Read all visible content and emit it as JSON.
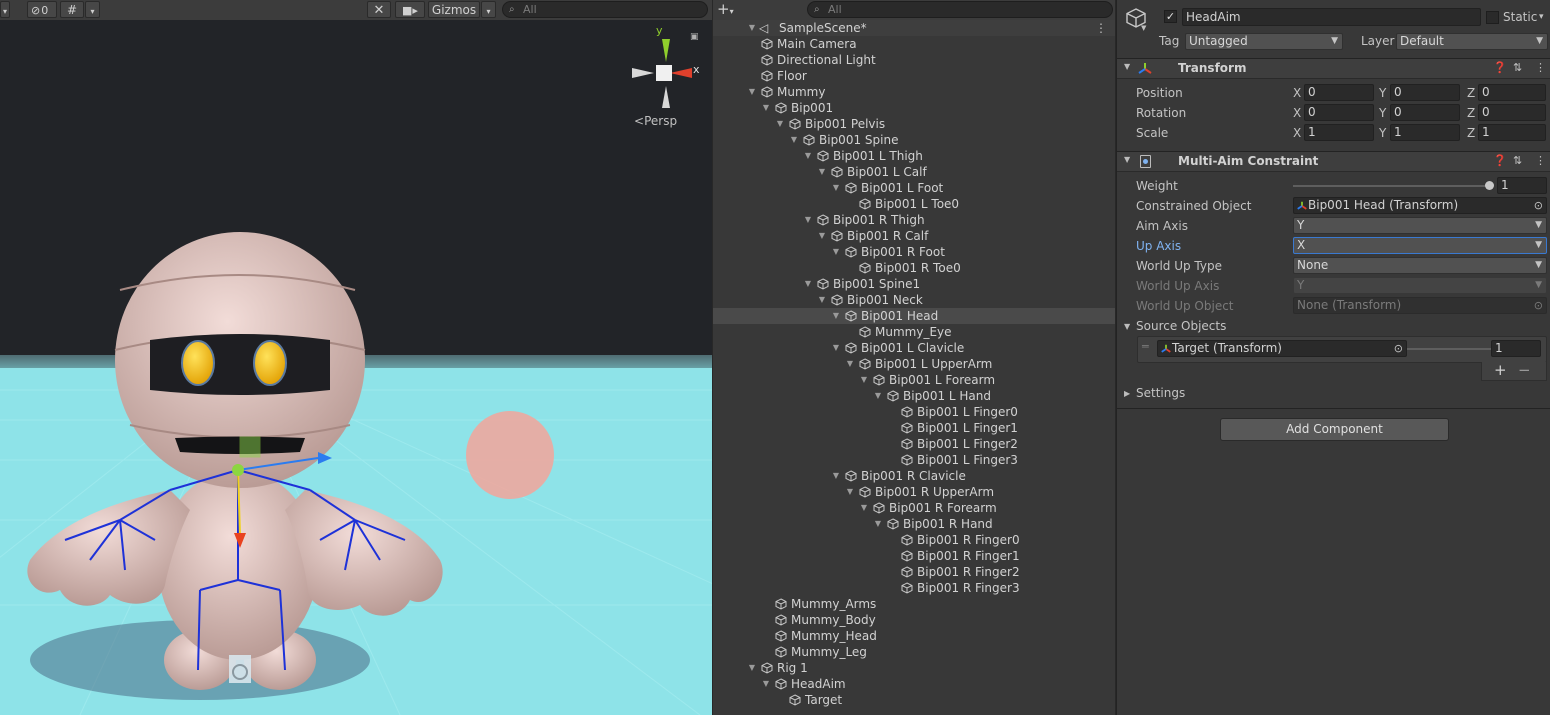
{
  "scene": {
    "toolbar": {
      "hidden_count": "0",
      "gizmos_label": "Gizmos",
      "search_placeholder": "All"
    },
    "gizmo": {
      "y_label": "y",
      "x_label": "x",
      "projection_label": "Persp"
    }
  },
  "hierarchy": {
    "toolbar": {
      "add_label": "+",
      "search_placeholder": "All"
    },
    "scene_name": "SampleScene*",
    "items": [
      {
        "label": "Main Camera",
        "depth": 1,
        "arrow": ""
      },
      {
        "label": "Directional Light",
        "depth": 1,
        "arrow": ""
      },
      {
        "label": "Floor",
        "depth": 1,
        "arrow": ""
      },
      {
        "label": "Mummy",
        "depth": 1,
        "arrow": "down"
      },
      {
        "label": "Bip001",
        "depth": 2,
        "arrow": "down"
      },
      {
        "label": "Bip001 Pelvis",
        "depth": 3,
        "arrow": "down"
      },
      {
        "label": "Bip001 Spine",
        "depth": 4,
        "arrow": "down"
      },
      {
        "label": "Bip001 L Thigh",
        "depth": 5,
        "arrow": "down"
      },
      {
        "label": "Bip001 L Calf",
        "depth": 6,
        "arrow": "down"
      },
      {
        "label": "Bip001 L Foot",
        "depth": 7,
        "arrow": "down"
      },
      {
        "label": "Bip001 L Toe0",
        "depth": 8,
        "arrow": ""
      },
      {
        "label": "Bip001 R Thigh",
        "depth": 5,
        "arrow": "down"
      },
      {
        "label": "Bip001 R Calf",
        "depth": 6,
        "arrow": "down"
      },
      {
        "label": "Bip001 R Foot",
        "depth": 7,
        "arrow": "down"
      },
      {
        "label": "Bip001 R Toe0",
        "depth": 8,
        "arrow": ""
      },
      {
        "label": "Bip001 Spine1",
        "depth": 5,
        "arrow": "down"
      },
      {
        "label": "Bip001 Neck",
        "depth": 6,
        "arrow": "down"
      },
      {
        "label": "Bip001 Head",
        "depth": 7,
        "arrow": "down",
        "selected": true
      },
      {
        "label": "Mummy_Eye",
        "depth": 8,
        "arrow": ""
      },
      {
        "label": "Bip001 L Clavicle",
        "depth": 7,
        "arrow": "down"
      },
      {
        "label": "Bip001 L UpperArm",
        "depth": 8,
        "arrow": "down"
      },
      {
        "label": "Bip001 L Forearm",
        "depth": 9,
        "arrow": "down"
      },
      {
        "label": "Bip001 L Hand",
        "depth": 10,
        "arrow": "down"
      },
      {
        "label": "Bip001 L Finger0",
        "depth": 11,
        "arrow": ""
      },
      {
        "label": "Bip001 L Finger1",
        "depth": 11,
        "arrow": ""
      },
      {
        "label": "Bip001 L Finger2",
        "depth": 11,
        "arrow": ""
      },
      {
        "label": "Bip001 L Finger3",
        "depth": 11,
        "arrow": ""
      },
      {
        "label": "Bip001 R Clavicle",
        "depth": 7,
        "arrow": "down"
      },
      {
        "label": "Bip001 R UpperArm",
        "depth": 8,
        "arrow": "down"
      },
      {
        "label": "Bip001 R Forearm",
        "depth": 9,
        "arrow": "down"
      },
      {
        "label": "Bip001 R Hand",
        "depth": 10,
        "arrow": "down"
      },
      {
        "label": "Bip001 R Finger0",
        "depth": 11,
        "arrow": ""
      },
      {
        "label": "Bip001 R Finger1",
        "depth": 11,
        "arrow": ""
      },
      {
        "label": "Bip001 R Finger2",
        "depth": 11,
        "arrow": ""
      },
      {
        "label": "Bip001 R Finger3",
        "depth": 11,
        "arrow": ""
      },
      {
        "label": "Mummy_Arms",
        "depth": 2,
        "arrow": ""
      },
      {
        "label": "Mummy_Body",
        "depth": 2,
        "arrow": ""
      },
      {
        "label": "Mummy_Head",
        "depth": 2,
        "arrow": ""
      },
      {
        "label": "Mummy_Leg",
        "depth": 2,
        "arrow": ""
      },
      {
        "label": "Rig 1",
        "depth": 1,
        "arrow": "down"
      },
      {
        "label": "HeadAim",
        "depth": 2,
        "arrow": "down"
      },
      {
        "label": "Target",
        "depth": 3,
        "arrow": ""
      }
    ]
  },
  "inspector": {
    "object_name": "HeadAim",
    "active_checked": true,
    "static_label": "Static",
    "tag_label": "Tag",
    "tag_value": "Untagged",
    "layer_label": "Layer",
    "layer_value": "Default",
    "transform": {
      "title": "Transform",
      "position_label": "Position",
      "rotation_label": "Rotation",
      "scale_label": "Scale",
      "x": "X",
      "y": "Y",
      "z": "Z",
      "position": [
        "0",
        "0",
        "0"
      ],
      "rotation": [
        "0",
        "0",
        "0"
      ],
      "scale": [
        "1",
        "1",
        "1"
      ]
    },
    "constraint": {
      "title": "Multi-Aim Constraint",
      "weight_label": "Weight",
      "weight_value": "1",
      "weight_fraction": 1.0,
      "constrained_label": "Constrained Object",
      "constrained_value": "Bip001 Head (Transform)",
      "aim_axis_label": "Aim Axis",
      "aim_axis_value": "Y",
      "up_axis_label": "Up Axis",
      "up_axis_value": "X",
      "world_up_type_label": "World Up Type",
      "world_up_type_value": "None",
      "world_up_axis_label": "World Up Axis",
      "world_up_axis_value": "Y",
      "world_up_object_label": "World Up Object",
      "world_up_object_value": "None (Transform)",
      "source_objects_label": "Source Objects",
      "source_name": "Target (Transform)",
      "source_weight": "1",
      "source_weight_fraction": 1.0,
      "add_symbol": "+",
      "remove_symbol": "−",
      "settings_label": "Settings"
    },
    "add_component_label": "Add Component"
  },
  "colors": {
    "panel_bg": "#383838",
    "toolbar_bg": "#3c3c3c",
    "selection": "#4a4a4a",
    "sky": "#8fe6ea",
    "up_axis_label": "#7fb2f0",
    "gizmo_x": "#e0402c",
    "gizmo_y": "#8fce2c"
  }
}
